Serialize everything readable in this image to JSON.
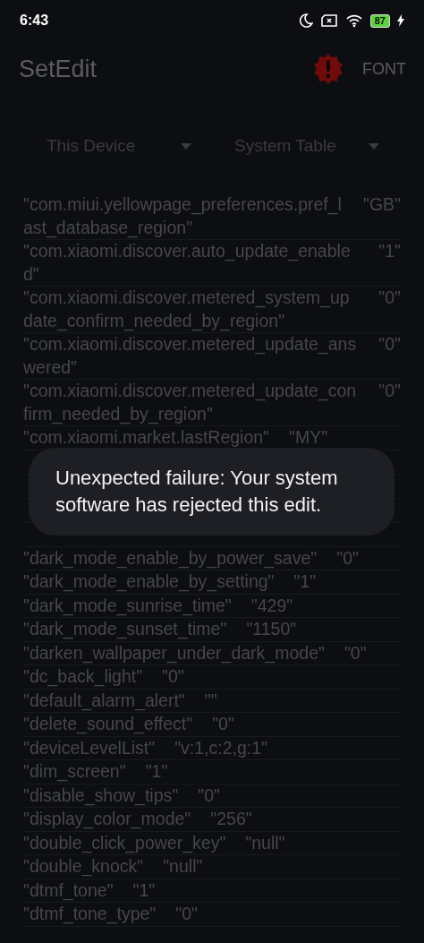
{
  "status_bar": {
    "time": "6:43",
    "battery": "87"
  },
  "app_bar": {
    "title": "SetEdit",
    "action": "FONT"
  },
  "selectors": [
    {
      "label": "This Device"
    },
    {
      "label": "System Table"
    }
  ],
  "settings": [
    {
      "kind": "wrapped",
      "key": "\"com.miui.yellowpage_preferences.pref_last_database_region\"",
      "value": "\"GB\""
    },
    {
      "kind": "wrapped",
      "key": "\"com.xiaomi.discover.auto_update_enabled\"",
      "value": "\"1\""
    },
    {
      "kind": "wrapped",
      "key": "\"com.xiaomi.discover.metered_system_update_confirm_needed_by_region\"",
      "value": "\"0\""
    },
    {
      "kind": "wrapped",
      "key": "\"com.xiaomi.discover.metered_update_answered\"",
      "value": "\"0\""
    },
    {
      "kind": "wrapped",
      "key": "\"com.xiaomi.discover.metered_update_confirm_needed_by_region\"",
      "value": "\"0\""
    },
    {
      "kind": "inline",
      "key": "\"com.xiaomi.market.lastRegion\"",
      "value": "\"MY\""
    },
    {
      "kind": "hidden"
    },
    {
      "kind": "hidden"
    },
    {
      "kind": "hidden"
    },
    {
      "kind": "hidden"
    },
    {
      "kind": "inline",
      "key": "\"dark_mode_enable_by_power_save\"",
      "value": "\"0\""
    },
    {
      "kind": "inline",
      "key": "\"dark_mode_enable_by_setting\"",
      "value": "\"1\""
    },
    {
      "kind": "inline",
      "key": "\"dark_mode_sunrise_time\"",
      "value": "\"429\""
    },
    {
      "kind": "inline",
      "key": "\"dark_mode_sunset_time\"",
      "value": "\"1150\""
    },
    {
      "kind": "inline",
      "key": "\"darken_wallpaper_under_dark_mode\"",
      "value": "\"0\""
    },
    {
      "kind": "inline",
      "key": "\"dc_back_light\"",
      "value": "\"0\""
    },
    {
      "kind": "inline",
      "key": "\"default_alarm_alert\"",
      "value": "\"\""
    },
    {
      "kind": "inline",
      "key": "\"delete_sound_effect\"",
      "value": "\"0\""
    },
    {
      "kind": "inline",
      "key": "\"deviceLevelList\"",
      "value": "\"v:1,c:2,g:1\""
    },
    {
      "kind": "inline",
      "key": "\"dim_screen\"",
      "value": "\"1\""
    },
    {
      "kind": "inline",
      "key": "\"disable_show_tips\"",
      "value": "\"0\""
    },
    {
      "kind": "inline",
      "key": "\"display_color_mode\"",
      "value": "\"256\""
    },
    {
      "kind": "inline",
      "key": "\"double_click_power_key\"",
      "value": "\"null\""
    },
    {
      "kind": "inline",
      "key": "\"double_knock\"",
      "value": "\"null\""
    },
    {
      "kind": "inline",
      "key": "\"dtmf_tone\"",
      "value": "\"1\""
    },
    {
      "kind": "inline",
      "key": "\"dtmf_tone_type\"",
      "value": "\"0\""
    }
  ],
  "toast": {
    "message": "Unexpected failure: Your system software has rejected this edit."
  }
}
